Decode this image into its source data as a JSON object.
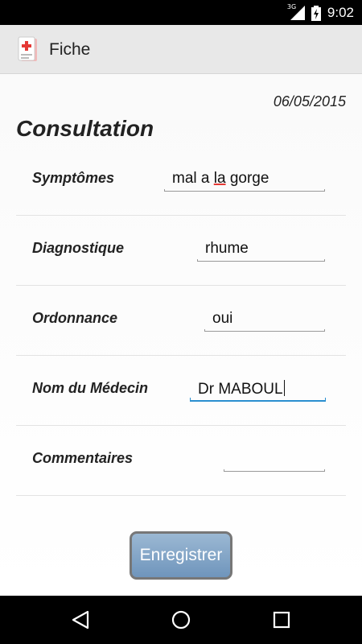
{
  "status_bar": {
    "network": "3G",
    "time": "9:02",
    "icons": [
      "signal-icon",
      "battery-charging-icon"
    ]
  },
  "app": {
    "title": "Fiche",
    "icon": "medical-record-icon",
    "accent_color": "#2a8fd0"
  },
  "form": {
    "date": "06/05/2015",
    "heading": "Consultation",
    "fields": [
      {
        "label": "Symptômes",
        "value_before": "mal a ",
        "value_misspelled": "la",
        "value_after": " gorge"
      },
      {
        "label": "Diagnostique",
        "value": "rhume"
      },
      {
        "label": "Ordonnance",
        "value": "oui"
      },
      {
        "label": "Nom du Médecin",
        "value": "Dr MABOUL",
        "focused": true
      },
      {
        "label": "Commentaires",
        "value": ""
      }
    ],
    "save_label": "Enregistrer"
  },
  "nav_bar": {
    "buttons": [
      "back-icon",
      "home-icon",
      "recents-icon"
    ]
  }
}
